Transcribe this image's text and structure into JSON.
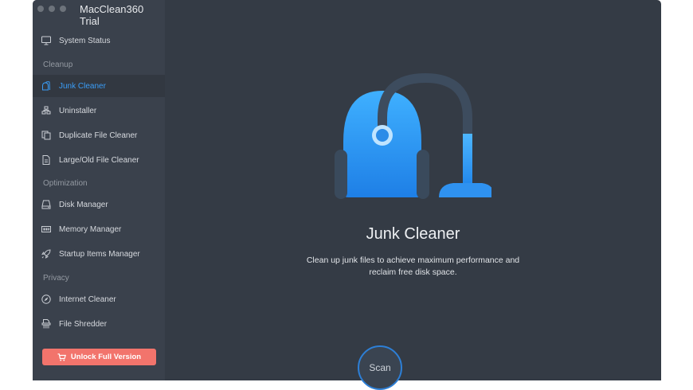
{
  "window": {
    "title": "MacClean360 Trial"
  },
  "sidebar": {
    "top_item": {
      "label": "System Status",
      "icon": "monitor-icon"
    },
    "sections": [
      {
        "label": "Cleanup",
        "items": [
          {
            "label": "Junk Cleaner",
            "icon": "vacuum-icon",
            "active": true
          },
          {
            "label": "Uninstaller",
            "icon": "uninstaller-icon"
          },
          {
            "label": "Duplicate File Cleaner",
            "icon": "duplicate-icon"
          },
          {
            "label": "Large/Old File Cleaner",
            "icon": "file-icon"
          }
        ]
      },
      {
        "label": "Optimization",
        "items": [
          {
            "label": "Disk Manager",
            "icon": "disk-icon"
          },
          {
            "label": "Memory Manager",
            "icon": "memory-icon"
          },
          {
            "label": "Startup Items Manager",
            "icon": "rocket-icon"
          }
        ]
      },
      {
        "label": "Privacy",
        "items": [
          {
            "label": "Internet Cleaner",
            "icon": "compass-icon"
          },
          {
            "label": "File Shredder",
            "icon": "shredder-icon"
          }
        ]
      }
    ],
    "unlock_button": {
      "label": "Unlock Full Version",
      "icon": "cart-icon"
    }
  },
  "main": {
    "title": "Junk Cleaner",
    "description_line1": "Clean up junk files to achieve maximum performance and",
    "description_line2": "reclaim free disk space.",
    "scan_button": "Scan",
    "hero_icon": "vacuum-cleaner-icon"
  },
  "colors": {
    "accent": "#3a9df7",
    "sidebar_bg": "#3a414c",
    "main_bg": "#343b45",
    "unlock_bg": "#f2746c"
  }
}
